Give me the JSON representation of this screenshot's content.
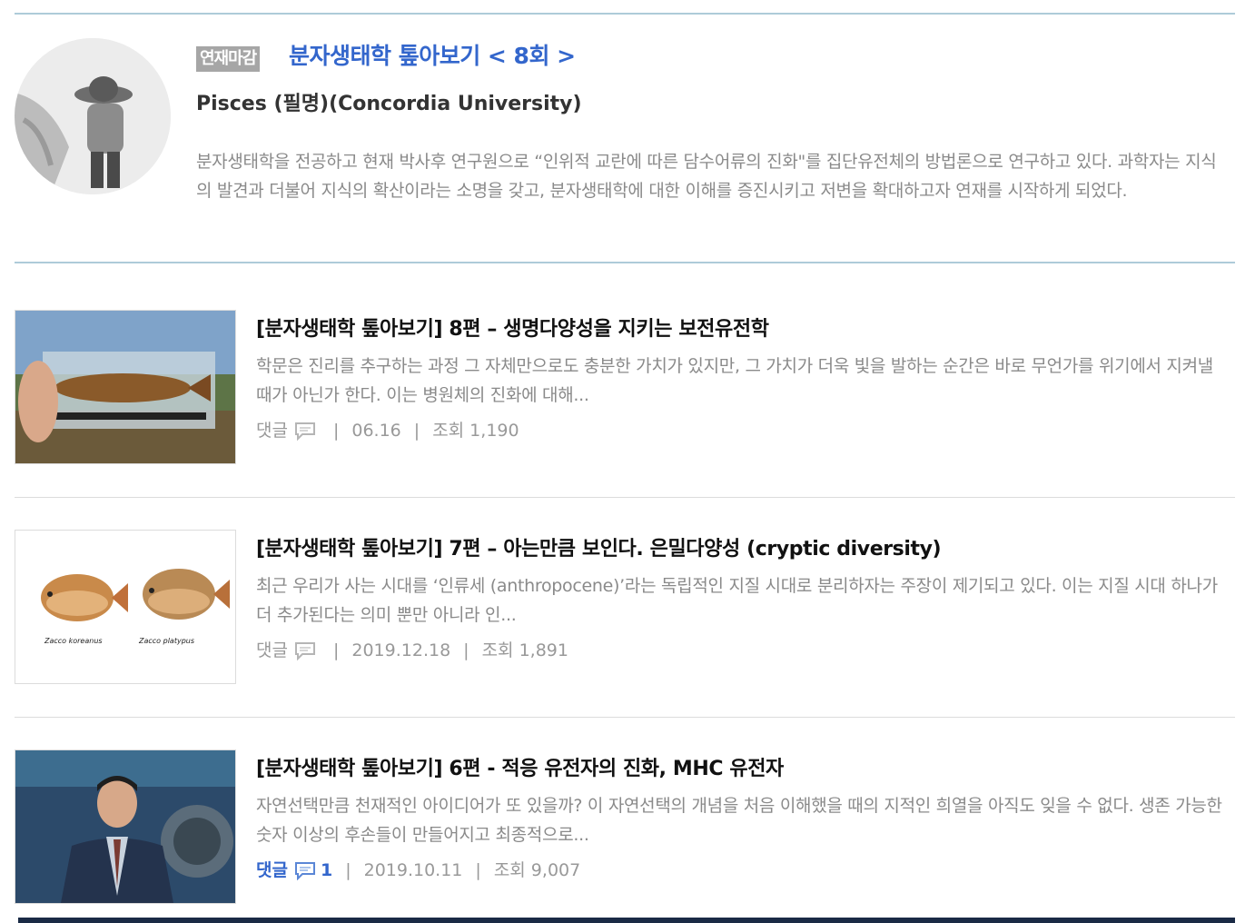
{
  "series": {
    "tag": "연재마감",
    "title": "분자생태학 톺아보기 < 8회 >",
    "author": "Pisces (필명)(Concordia University)",
    "bio": "분자생태학을 전공하고 현재 박사후 연구원으로 “인위적 교란에 따른 담수어류의 진화\"를 집단유전체의 방법론으로 연구하고 있다. 과학자는 지식의 발견과 더불어 지식의 확산이라는 소명을 갖고, 분자생태학에 대한 이해를 증진시키고 저변을 확대하고자 연재를 시작하게 되었다."
  },
  "articles": [
    {
      "title": "[분자생태학 톺아보기] 8편 – 생명다양성을 지키는 보전유전학",
      "summary": "학문은 진리를 추구하는 과정 그 자체만으로도 충분한 가치가 있지만, 그 가치가 더욱 빛을 발하는 순간은 바로 무언가를 위기에서 지켜낼 때가 아닌가 한다. 이는 병원체의 진화에 대해...",
      "comment_label": "댓글",
      "comment_count": "",
      "date": "06.16",
      "views": "조회 1,190",
      "thumb_icon": "fish-in-hand-photo"
    },
    {
      "title": "[분자생태학 톺아보기] 7편 – 아는만큼 보인다. 은밀다양성 (cryptic diversity)",
      "summary": "최근 우리가 사는 시대를 ‘인류세 (anthropocene)’라는 독립적인 지질 시대로 분리하자는 주장이 제기되고 있다. 이는 지질 시대 하나가 더 추가된다는 의미 뿐만 아니라 인...",
      "comment_label": "댓글",
      "comment_count": "",
      "date": "2019.12.18",
      "views": "조회 1,891",
      "thumb_icon": "two-fish-illustration",
      "thumb_captions": [
        "Zacco koreanus",
        "Zacco platypus"
      ]
    },
    {
      "title": "[분자생태학 톺아보기] 6편 - 적응 유전자의 진화, MHC 유전자",
      "summary": "자연선택만큼 천재적인 아이디어가 또 있을까? 이 자연선택의 개념을 처음 이해했을 때의 지적인 희열을 아직도 잊을 수 없다. 생존 가능한 숫자 이상의 후손들이 만들어지고 최종적으로...",
      "comment_label": "댓글",
      "comment_count": "1",
      "date": "2019.10.11",
      "views": "조회 9,007",
      "thumb_icon": "man-in-suit-photo"
    }
  ],
  "colors": {
    "accent_blue": "#3366cc",
    "rule_blue": "#aecbd9",
    "muted_text": "#8a8a8a",
    "bottom_bar": "#1a2a45"
  }
}
